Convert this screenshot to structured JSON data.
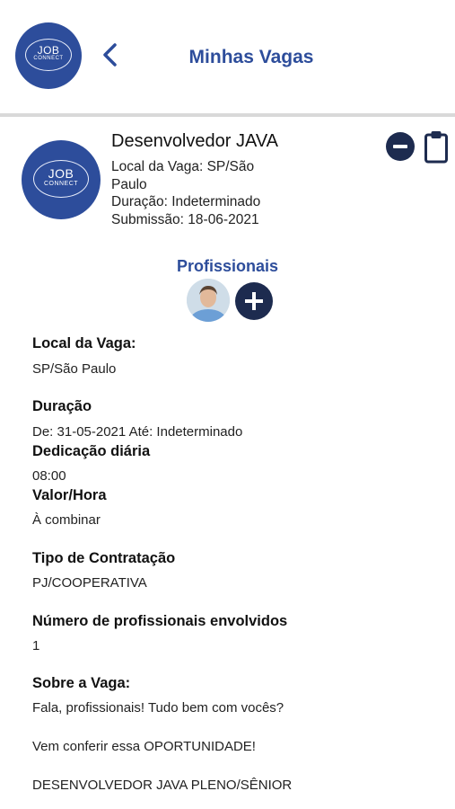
{
  "header": {
    "logo_line1": "JOB",
    "logo_line2": "CONNECT",
    "title": "Minhas Vagas"
  },
  "job": {
    "logo_line1": "JOB",
    "logo_line2": "CONNECT",
    "title": "Desenvolvedor JAVA",
    "local_line1": "Local da Vaga: SP/São",
    "local_line2": "Paulo",
    "duracao": "Duração: Indeterminado",
    "submissao": "Submissão: 18-06-2021"
  },
  "profissionais": {
    "title": "Profissionais"
  },
  "details": {
    "local_label": "Local da Vaga:",
    "local_value": "SP/São Paulo",
    "duracao_label": "Duração",
    "duracao_value": "De: 31-05-2021 Até: Indeterminado",
    "dedicacao_label": "Dedicação diária",
    "dedicacao_value": "08:00",
    "valor_label": "Valor/Hora",
    "valor_value": "À combinar",
    "tipo_label": "Tipo de Contratação",
    "tipo_value": "PJ/COOPERATIVA",
    "numero_label": "Número de profissionais envolvidos",
    "numero_value": "1",
    "sobre_label": "Sobre a Vaga:",
    "sobre_line1": "Fala, profissionais!  Tudo bem com vocês?",
    "sobre_line2": "Vem conferir essa OPORTUNIDADE!",
    "sobre_line3": "DESENVOLVEDOR JAVA PLENO/SÊNIOR"
  },
  "colors": {
    "brand_blue": "#2d4d9b",
    "dark_navy": "#1d2b4f",
    "divider": "#d9d9d9"
  },
  "icons": [
    "back-chevron-icon",
    "remove-circle-icon",
    "clipboard-icon",
    "add-circle-icon"
  ]
}
